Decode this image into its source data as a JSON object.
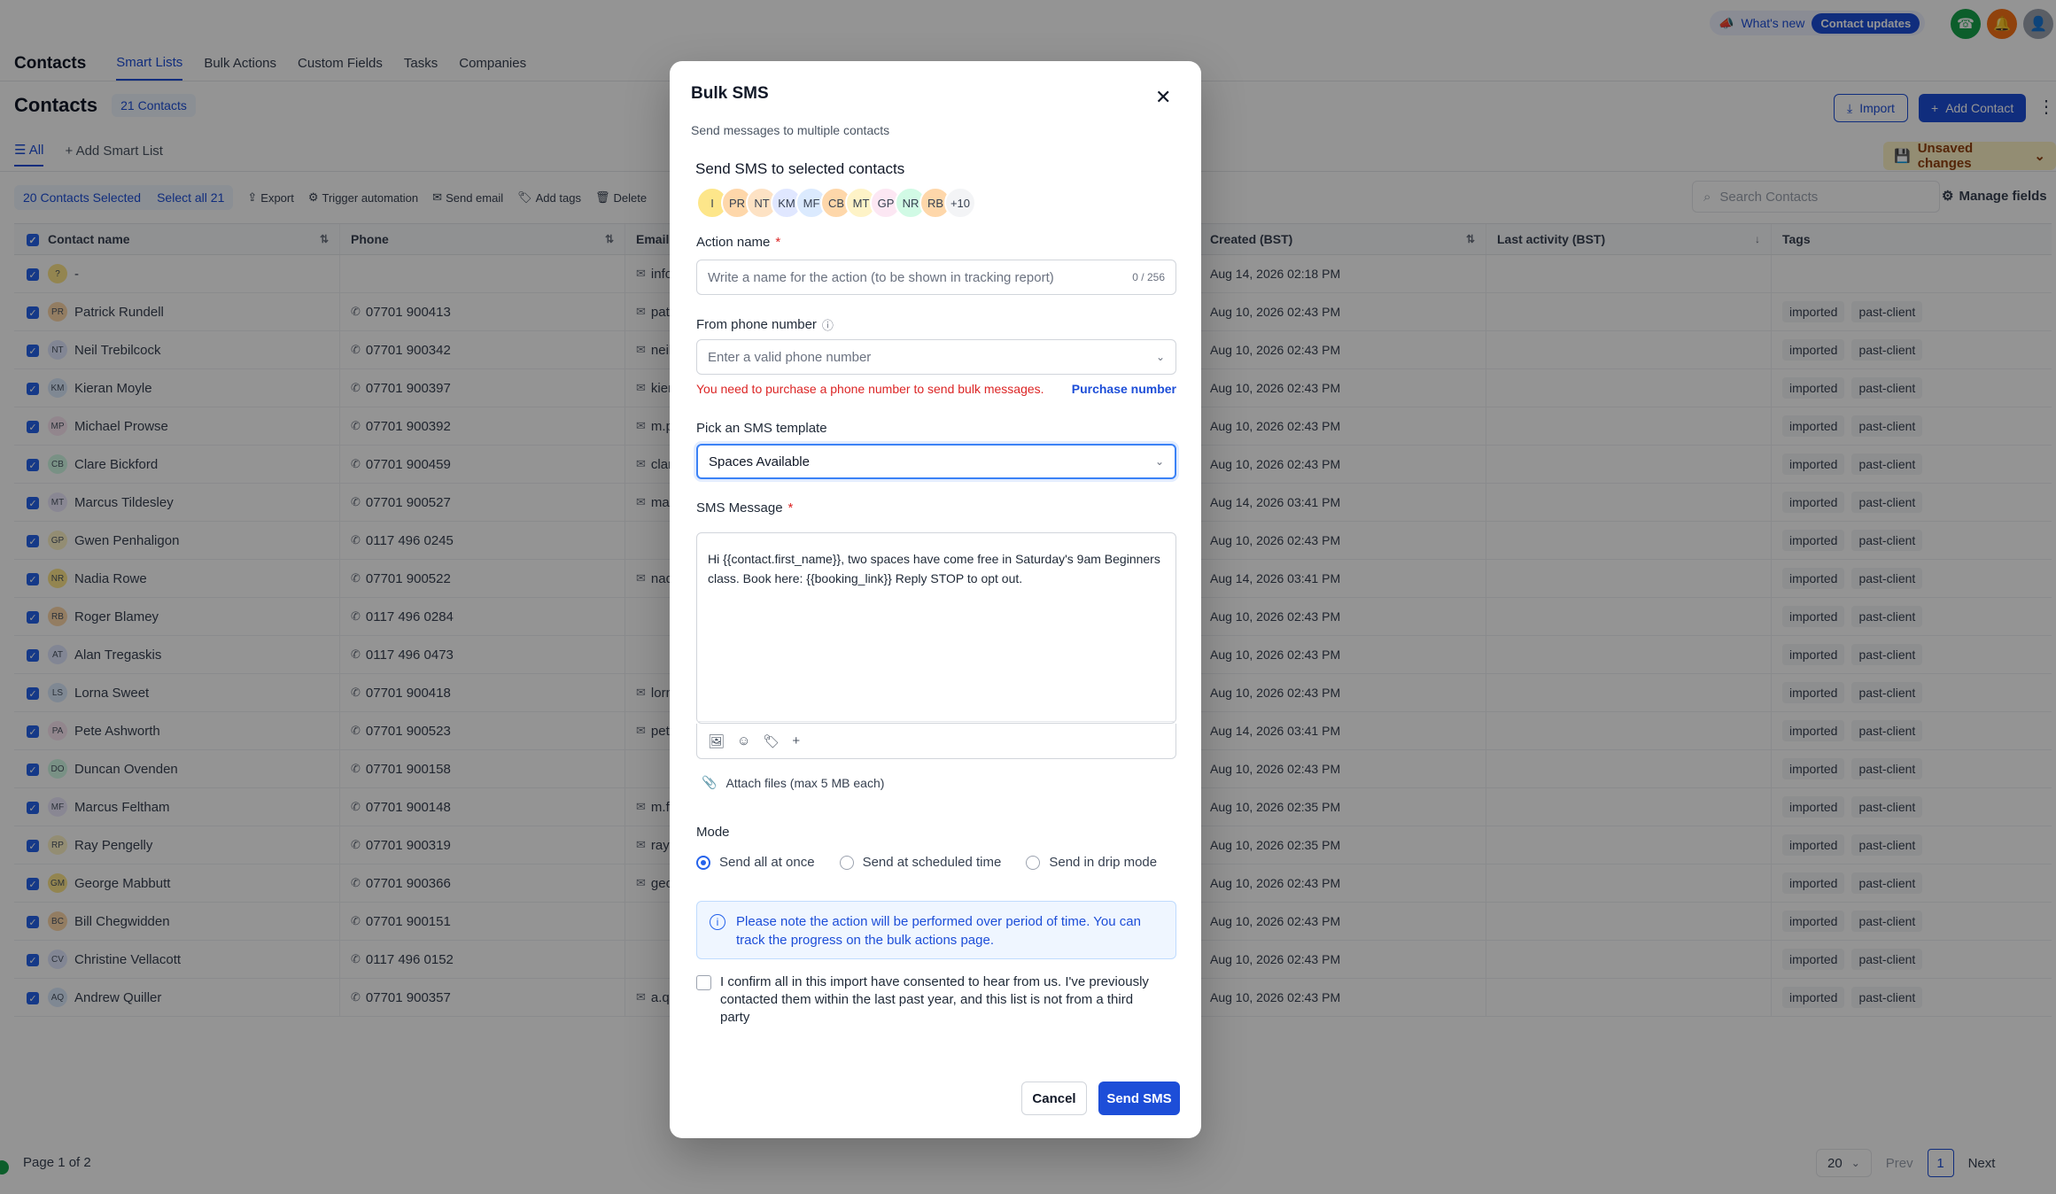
{
  "topbar": {
    "whats_new": "What's new",
    "contact_updates": "Contact updates"
  },
  "subnav": {
    "brand": "Contacts",
    "tabs": [
      "Smart Lists",
      "Bulk Actions",
      "Custom Fields",
      "Tasks",
      "Companies"
    ]
  },
  "heading": {
    "title": "Contacts",
    "count": "21 Contacts",
    "import": "Import",
    "add_contact": "Add Contact"
  },
  "listtabs": {
    "all": "All",
    "add": "Add Smart List",
    "unsaved": "Unsaved changes"
  },
  "actions": {
    "selected": "20 Contacts Selected",
    "select_all": "Select all 21",
    "export": "Export",
    "trigger": "Trigger automation",
    "send_email": "Send email",
    "add_tags": "Add tags",
    "delete": "Delete",
    "search_placeholder": "Search Contacts",
    "manage_fields": "Manage fields"
  },
  "table": {
    "headers": {
      "name": "Contact name",
      "phone": "Phone",
      "email": "Email",
      "created": "Created (BST)",
      "last": "Last activity (BST)",
      "tags": "Tags"
    },
    "rows": [
      {
        "initials": "?",
        "name": "-",
        "phone": "",
        "email": "info",
        "created": "Aug 14, 2026 02:18 PM",
        "tags": []
      },
      {
        "initials": "PR",
        "name": "Patrick Rundell",
        "phone": "07701 900413",
        "email": "pat",
        "created": "Aug 10, 2026 02:43 PM",
        "tags": [
          "imported",
          "past-client"
        ]
      },
      {
        "initials": "NT",
        "name": "Neil Trebilcock",
        "phone": "07701 900342",
        "email": "neil",
        "created": "Aug 10, 2026 02:43 PM",
        "tags": [
          "imported",
          "past-client"
        ]
      },
      {
        "initials": "KM",
        "name": "Kieran Moyle",
        "phone": "07701 900397",
        "email": "kier",
        "created": "Aug 10, 2026 02:43 PM",
        "tags": [
          "imported",
          "past-client"
        ]
      },
      {
        "initials": "MP",
        "name": "Michael Prowse",
        "phone": "07701 900392",
        "email": "m.p",
        "created": "Aug 10, 2026 02:43 PM",
        "tags": [
          "imported",
          "past-client"
        ]
      },
      {
        "initials": "CB",
        "name": "Clare Bickford",
        "phone": "07701 900459",
        "email": "clar",
        "created": "Aug 10, 2026 02:43 PM",
        "tags": [
          "imported",
          "past-client"
        ]
      },
      {
        "initials": "MT",
        "name": "Marcus Tildesley",
        "phone": "07701 900527",
        "email": "mar",
        "created": "Aug 14, 2026 03:41 PM",
        "tags": [
          "imported",
          "past-client"
        ]
      },
      {
        "initials": "GP",
        "name": "Gwen Penhaligon",
        "phone": "0117 496 0245",
        "email": "",
        "created": "Aug 10, 2026 02:43 PM",
        "tags": [
          "imported",
          "past-client"
        ]
      },
      {
        "initials": "NR",
        "name": "Nadia Rowe",
        "phone": "07701 900522",
        "email": "nad",
        "created": "Aug 14, 2026 03:41 PM",
        "tags": [
          "imported",
          "past-client"
        ]
      },
      {
        "initials": "RB",
        "name": "Roger Blamey",
        "phone": "0117 496 0284",
        "email": "",
        "created": "Aug 10, 2026 02:43 PM",
        "tags": [
          "imported",
          "past-client"
        ]
      },
      {
        "initials": "AT",
        "name": "Alan Tregaskis",
        "phone": "0117 496 0473",
        "email": "",
        "created": "Aug 10, 2026 02:43 PM",
        "tags": [
          "imported",
          "past-client"
        ]
      },
      {
        "initials": "LS",
        "name": "Lorna Sweet",
        "phone": "07701 900418",
        "email": "lorn",
        "created": "Aug 10, 2026 02:43 PM",
        "tags": [
          "imported",
          "past-client"
        ]
      },
      {
        "initials": "PA",
        "name": "Pete Ashworth",
        "phone": "07701 900523",
        "email": "pet",
        "created": "Aug 14, 2026 03:41 PM",
        "tags": [
          "imported",
          "past-client"
        ]
      },
      {
        "initials": "DO",
        "name": "Duncan Ovenden",
        "phone": "07701 900158",
        "email": "",
        "created": "Aug 10, 2026 02:43 PM",
        "tags": [
          "imported",
          "past-client"
        ]
      },
      {
        "initials": "MF",
        "name": "Marcus Feltham",
        "phone": "07701 900148",
        "email": "m.fe",
        "created": "Aug 10, 2026 02:35 PM",
        "tags": [
          "imported",
          "past-client"
        ]
      },
      {
        "initials": "RP",
        "name": "Ray Pengelly",
        "phone": "07701 900319",
        "email": "ray.",
        "created": "Aug 10, 2026 02:35 PM",
        "tags": [
          "imported",
          "past-client"
        ]
      },
      {
        "initials": "GM",
        "name": "George Mabbutt",
        "phone": "07701 900366",
        "email": "geo",
        "created": "Aug 10, 2026 02:43 PM",
        "tags": [
          "imported",
          "past-client"
        ]
      },
      {
        "initials": "BC",
        "name": "Bill Chegwidden",
        "phone": "07701 900151",
        "email": "",
        "created": "Aug 10, 2026 02:43 PM",
        "tags": [
          "imported",
          "past-client"
        ]
      },
      {
        "initials": "CV",
        "name": "Christine Vellacott",
        "phone": "0117 496 0152",
        "email": "",
        "created": "Aug 10, 2026 02:43 PM",
        "tags": [
          "imported",
          "past-client"
        ]
      },
      {
        "initials": "AQ",
        "name": "Andrew Quiller",
        "phone": "07701 900357",
        "email": "a.q",
        "created": "Aug 10, 2026 02:43 PM",
        "tags": [
          "imported",
          "past-client"
        ]
      }
    ]
  },
  "footer": {
    "page": "Page 1 of 2",
    "page_size": "20",
    "prev": "Prev",
    "current": "1",
    "next": "Next"
  },
  "modal": {
    "title": "Bulk SMS",
    "subtitle": "Send messages to multiple contacts",
    "section": "Send SMS to selected contacts",
    "avatars": [
      "I",
      "PR",
      "NT",
      "KM",
      "MF",
      "CB",
      "MT",
      "GP",
      "NR",
      "RB"
    ],
    "more": "+10",
    "action_name_label": "Action name",
    "action_name_placeholder": "Write a name for the action (to be shown in tracking report)",
    "action_name_counter": "0 / 256",
    "from_label": "From phone number",
    "from_placeholder": "Enter a valid phone number",
    "error_msg": "You need to purchase a phone number to send bulk messages.",
    "purchase_link": "Purchase number",
    "template_label": "Pick an SMS template",
    "template_value": "Spaces Available",
    "message_label": "SMS Message",
    "message_text": "Hi {{contact.first_name}}, two spaces have come free in Saturday's 9am Beginners class. Book here: {{booking_link}} Reply STOP to opt out.",
    "attach": "Attach files (max 5 MB each)",
    "mode_label": "Mode",
    "modes": [
      "Send all at once",
      "Send at scheduled time",
      "Send in drip mode"
    ],
    "note": "Please note the action will be performed over period of time. You can track the progress on the bulk actions page.",
    "consent": "I confirm all in this import have consented to hear from us. I've previously contacted them within the last past year, and this list is not from a third party",
    "cancel": "Cancel",
    "send": "Send SMS"
  },
  "colors": {
    "primary": "#1d4ed8",
    "error": "#dc2626",
    "warning_bg": "#fef3c7"
  }
}
